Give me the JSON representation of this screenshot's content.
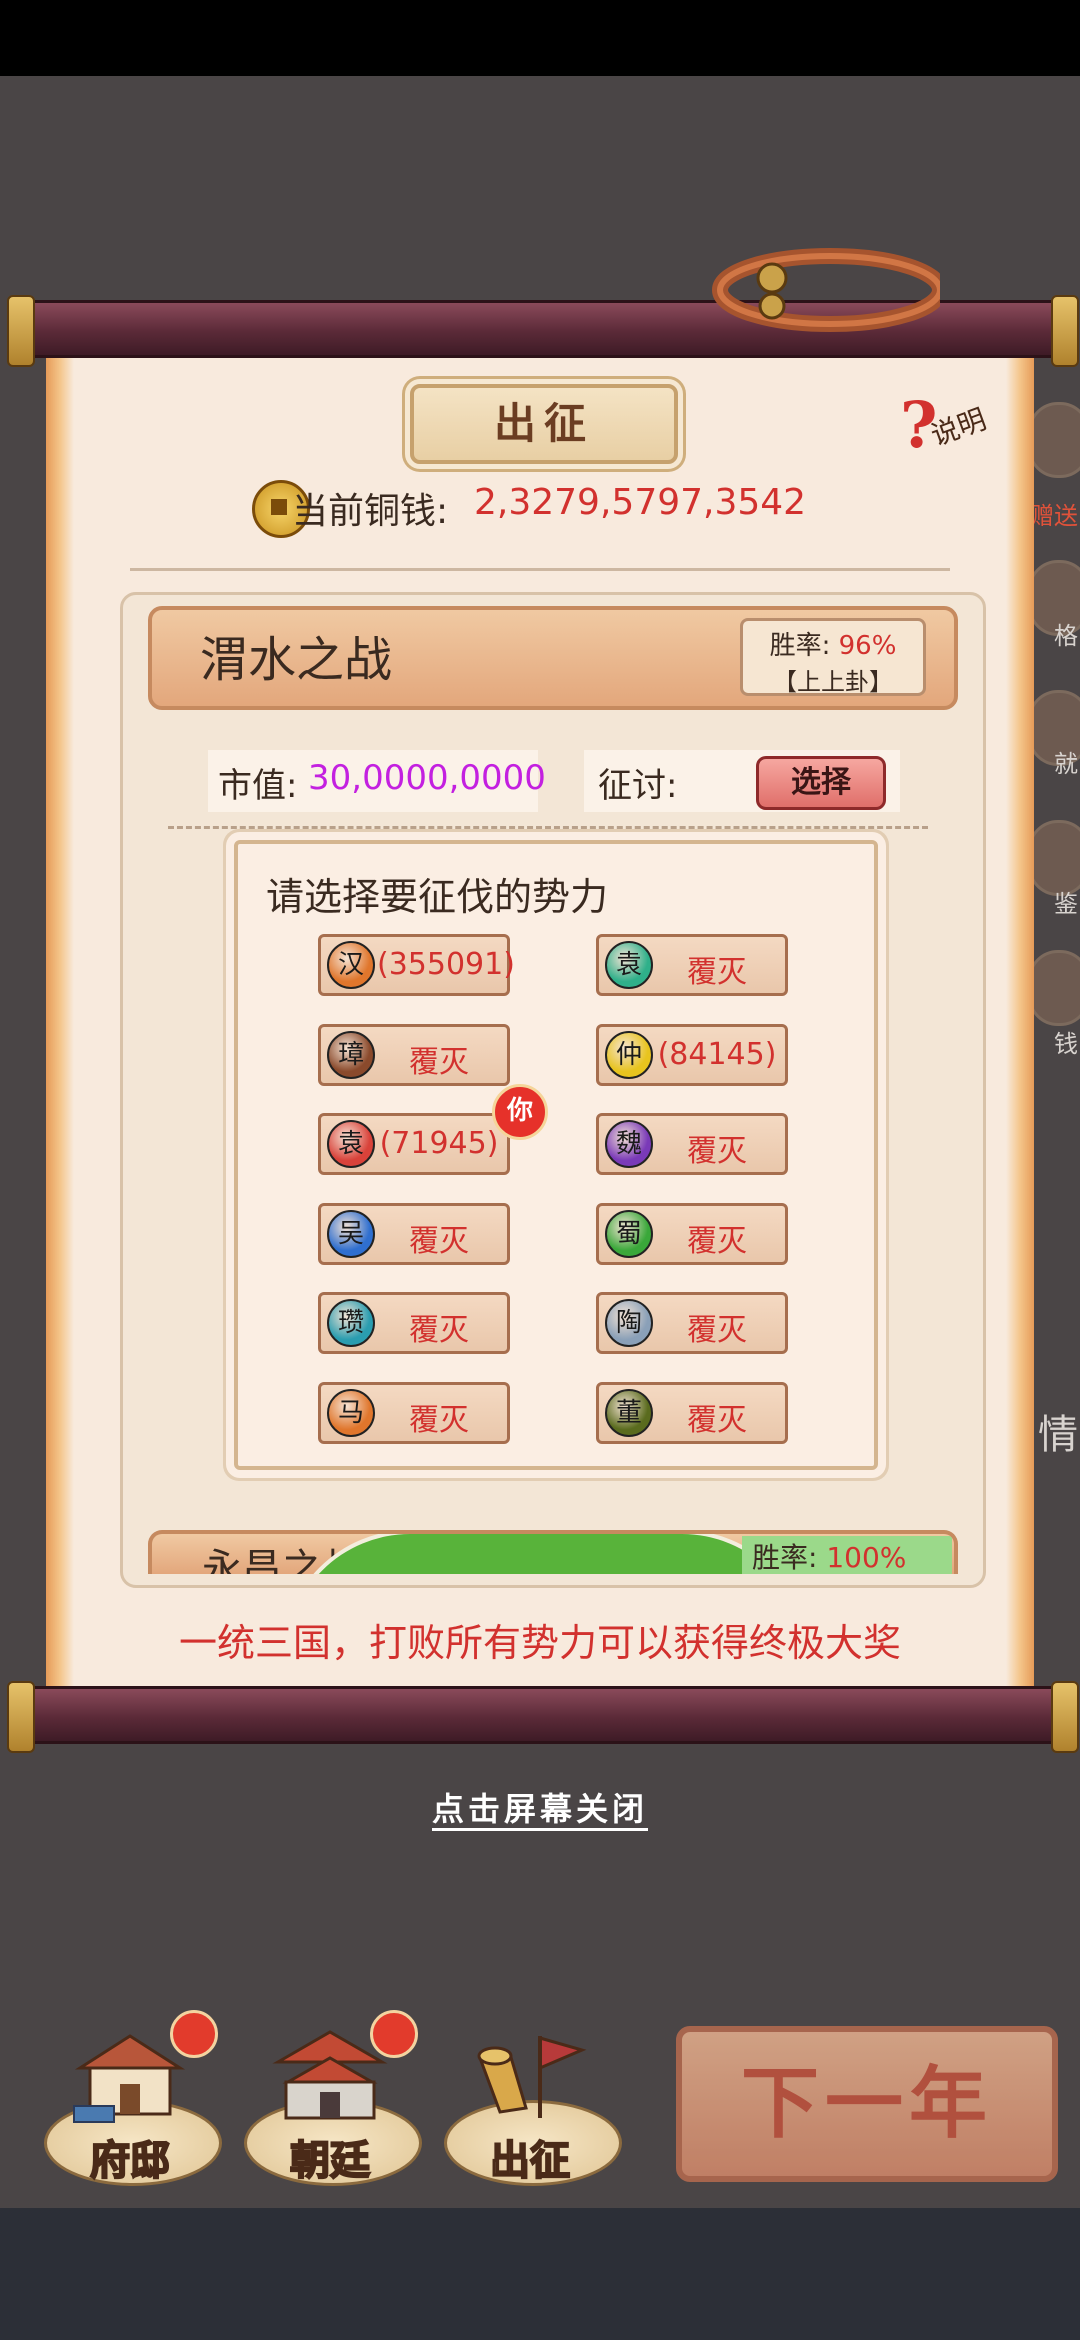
{
  "dialog": {
    "title": "出征",
    "help_label": "说明",
    "help_symbol": "?",
    "copper_label": "当前铜钱:",
    "copper_value": "2,3279,5797,3542"
  },
  "battle": {
    "name": "渭水之战",
    "win_rate_label": "胜率:",
    "win_rate_value": "96%",
    "win_rate_tag": "【上上卦】",
    "market_value_label": "市值:",
    "market_value": "30,0000,0000",
    "campaign_label": "征讨:",
    "select_button": "选择"
  },
  "faction_popup": {
    "title": "请选择要征伐的势力",
    "you_badge": "你",
    "factions": [
      {
        "glyph": "汉",
        "status": "(355091)",
        "icon_color": "#e0762c"
      },
      {
        "glyph": "袁",
        "status": "覆灭",
        "icon_color": "#2fb08a"
      },
      {
        "glyph": "璋",
        "status": "覆灭",
        "icon_color": "#8a4a2c"
      },
      {
        "glyph": "仲",
        "status": "(84145)",
        "icon_color": "#e8c41e"
      },
      {
        "glyph": "袁",
        "status": "(71945)",
        "icon_color": "#d9423a"
      },
      {
        "glyph": "魏",
        "status": "覆灭",
        "icon_color": "#7a3ab8"
      },
      {
        "glyph": "吴",
        "status": "覆灭",
        "icon_color": "#2f6fd0"
      },
      {
        "glyph": "蜀",
        "status": "覆灭",
        "icon_color": "#3aa83a"
      },
      {
        "glyph": "瓒",
        "status": "覆灭",
        "icon_color": "#2a9db0"
      },
      {
        "glyph": "陶",
        "status": "覆灭",
        "icon_color": "#8aa0b8"
      },
      {
        "glyph": "马",
        "status": "覆灭",
        "icon_color": "#e0762c"
      },
      {
        "glyph": "董",
        "status": "覆灭",
        "icon_color": "#5a6b1e"
      }
    ]
  },
  "next_battle": {
    "name_partial": "永昌之战",
    "win_rate_label": "胜率:",
    "win_rate_value": "100%"
  },
  "slogan": "一统三国，打败所有势力可以获得终极大奖",
  "close_hint": "点击屏幕关闭",
  "side_labels": [
    "赠送",
    "格",
    "就",
    "鉴",
    "钱",
    "情"
  ],
  "bottom_nav": {
    "items": [
      {
        "label": "府邸",
        "has_dot": true
      },
      {
        "label": "朝廷",
        "has_dot": true
      },
      {
        "label": "出征",
        "has_dot": false
      }
    ],
    "next_year": "下一年"
  },
  "colors": {
    "accent_red": "#d2312e",
    "market_value_purple": "#c320e0",
    "scroll_rod": "#5b2a38"
  }
}
